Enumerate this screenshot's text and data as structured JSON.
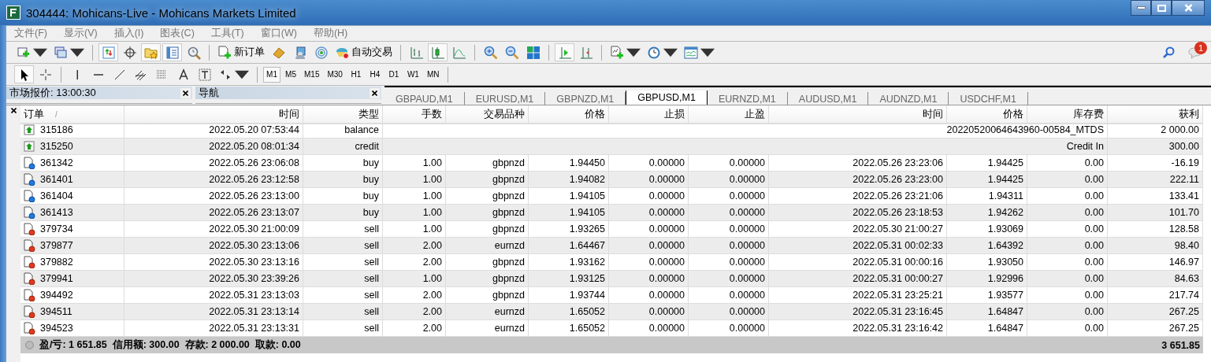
{
  "window": {
    "title": "304444: Mohicans-Live - Mohicans Markets Limited"
  },
  "menu": [
    "文件(F)",
    "显示(V)",
    "插入(I)",
    "图表(C)",
    "工具(T)",
    "窗口(W)",
    "帮助(H)"
  ],
  "toolbar": [
    {
      "kind": "icon",
      "pressed": false
    },
    {
      "kind": "icon",
      "pressed": false
    },
    {
      "kind": "separator"
    },
    {
      "kind": "icon",
      "pressed": true
    },
    {
      "kind": "icon",
      "pressed": false
    },
    {
      "kind": "icon",
      "pressed": true
    },
    {
      "kind": "icon",
      "pressed": true
    },
    {
      "kind": "icon",
      "pressed": false
    },
    {
      "kind": "separator"
    },
    {
      "kind": "labeled",
      "label": "新订单",
      "pressed": false
    },
    {
      "kind": "icon",
      "pressed": false
    },
    {
      "kind": "icon",
      "pressed": false
    },
    {
      "kind": "icon",
      "pressed": false
    },
    {
      "kind": "labeled",
      "label": "自动交易",
      "pressed": false
    },
    {
      "kind": "separator"
    },
    {
      "kind": "icon",
      "pressed": false
    },
    {
      "kind": "icon",
      "pressed": true
    },
    {
      "kind": "icon",
      "pressed": false
    },
    {
      "kind": "separator"
    },
    {
      "kind": "icon",
      "pressed": false
    },
    {
      "kind": "icon",
      "pressed": false
    },
    {
      "kind": "icon",
      "pressed": false
    },
    {
      "kind": "separator"
    },
    {
      "kind": "icon",
      "pressed": true
    },
    {
      "kind": "icon",
      "pressed": false
    },
    {
      "kind": "separator"
    },
    {
      "kind": "icon",
      "pressed": false
    },
    {
      "kind": "icon",
      "pressed": false
    },
    {
      "kind": "icon",
      "pressed": false
    }
  ],
  "notifications": {
    "badge": "1"
  },
  "drawing_tools": [
    {
      "pressed": true
    },
    {
      "pressed": false
    },
    {
      "pressed": false
    },
    {
      "pressed": false
    },
    {
      "pressed": false
    },
    {
      "pressed": false
    },
    {
      "pressed": false
    },
    {
      "pressed": false
    },
    {
      "pressed": false
    },
    {
      "pressed": false
    }
  ],
  "timeframes": [
    {
      "label": "M1",
      "selected": true
    },
    {
      "label": "M5",
      "selected": false
    },
    {
      "label": "M15",
      "selected": false
    },
    {
      "label": "M30",
      "selected": false
    },
    {
      "label": "H1",
      "selected": false
    },
    {
      "label": "H4",
      "selected": false
    },
    {
      "label": "D1",
      "selected": false
    },
    {
      "label": "W1",
      "selected": false
    },
    {
      "label": "MN",
      "selected": false
    }
  ],
  "panels": [
    {
      "title": "市场报价: 13:00:30"
    },
    {
      "title": "导航"
    }
  ],
  "chart_tabs": [
    {
      "label": "GBPAUD,M1",
      "selected": false
    },
    {
      "label": "EURUSD,M1",
      "selected": false
    },
    {
      "label": "GBPNZD,M1",
      "selected": false
    },
    {
      "label": "GBPUSD,M1",
      "selected": true
    },
    {
      "label": "EURNZD,M1",
      "selected": false
    },
    {
      "label": "AUDUSD,M1",
      "selected": false
    },
    {
      "label": "AUDNZD,M1",
      "selected": false
    },
    {
      "label": "USDCHF,M1",
      "selected": false
    }
  ],
  "table": {
    "columns": [
      "订单",
      "时间",
      "类型",
      "手数",
      "交易品种",
      "价格",
      "止损",
      "止盈",
      "时间",
      "价格",
      "库存费",
      "获利"
    ],
    "sort_mark": "/",
    "rows": [
      {
        "kind": "deposit",
        "order": "315186",
        "time": "2022.05.20 07:53:44",
        "type": "balance",
        "comment": "20220520064643960-00584_MTDS",
        "profit": "2 000.00"
      },
      {
        "kind": "deposit",
        "order": "315250",
        "time": "2022.05.20 08:01:34",
        "type": "credit",
        "comment": "Credit In",
        "profit": "300.00"
      },
      {
        "kind": "buy",
        "order": "361342",
        "time": "2022.05.26 23:06:08",
        "type": "buy",
        "lots": "1.00",
        "symbol": "gbpnzd",
        "price": "1.94450",
        "sl": "0.00000",
        "tp": "0.00000",
        "close_time": "2022.05.26 23:23:06",
        "close_price": "1.94425",
        "swap": "0.00",
        "profit": "-16.19"
      },
      {
        "kind": "buy",
        "order": "361401",
        "time": "2022.05.26 23:12:58",
        "type": "buy",
        "lots": "1.00",
        "symbol": "gbpnzd",
        "price": "1.94082",
        "sl": "0.00000",
        "tp": "0.00000",
        "close_time": "2022.05.26 23:23:00",
        "close_price": "1.94425",
        "swap": "0.00",
        "profit": "222.11"
      },
      {
        "kind": "buy",
        "order": "361404",
        "time": "2022.05.26 23:13:00",
        "type": "buy",
        "lots": "1.00",
        "symbol": "gbpnzd",
        "price": "1.94105",
        "sl": "0.00000",
        "tp": "0.00000",
        "close_time": "2022.05.26 23:21:06",
        "close_price": "1.94311",
        "swap": "0.00",
        "profit": "133.41"
      },
      {
        "kind": "buy",
        "order": "361413",
        "time": "2022.05.26 23:13:07",
        "type": "buy",
        "lots": "1.00",
        "symbol": "gbpnzd",
        "price": "1.94105",
        "sl": "0.00000",
        "tp": "0.00000",
        "close_time": "2022.05.26 23:18:53",
        "close_price": "1.94262",
        "swap": "0.00",
        "profit": "101.70"
      },
      {
        "kind": "sell",
        "order": "379734",
        "time": "2022.05.30 21:00:09",
        "type": "sell",
        "lots": "1.00",
        "symbol": "gbpnzd",
        "price": "1.93265",
        "sl": "0.00000",
        "tp": "0.00000",
        "close_time": "2022.05.30 21:00:27",
        "close_price": "1.93069",
        "swap": "0.00",
        "profit": "128.58"
      },
      {
        "kind": "sell",
        "order": "379877",
        "time": "2022.05.30 23:13:06",
        "type": "sell",
        "lots": "2.00",
        "symbol": "eurnzd",
        "price": "1.64467",
        "sl": "0.00000",
        "tp": "0.00000",
        "close_time": "2022.05.31 00:02:33",
        "close_price": "1.64392",
        "swap": "0.00",
        "profit": "98.40"
      },
      {
        "kind": "sell",
        "order": "379882",
        "time": "2022.05.30 23:13:16",
        "type": "sell",
        "lots": "2.00",
        "symbol": "gbpnzd",
        "price": "1.93162",
        "sl": "0.00000",
        "tp": "0.00000",
        "close_time": "2022.05.31 00:00:16",
        "close_price": "1.93050",
        "swap": "0.00",
        "profit": "146.97"
      },
      {
        "kind": "sell",
        "order": "379941",
        "time": "2022.05.30 23:39:26",
        "type": "sell",
        "lots": "1.00",
        "symbol": "gbpnzd",
        "price": "1.93125",
        "sl": "0.00000",
        "tp": "0.00000",
        "close_time": "2022.05.31 00:00:27",
        "close_price": "1.92996",
        "swap": "0.00",
        "profit": "84.63"
      },
      {
        "kind": "sell",
        "order": "394492",
        "time": "2022.05.31 23:13:03",
        "type": "sell",
        "lots": "2.00",
        "symbol": "gbpnzd",
        "price": "1.93744",
        "sl": "0.00000",
        "tp": "0.00000",
        "close_time": "2022.05.31 23:25:21",
        "close_price": "1.93577",
        "swap": "0.00",
        "profit": "217.74"
      },
      {
        "kind": "sell",
        "order": "394511",
        "time": "2022.05.31 23:13:14",
        "type": "sell",
        "lots": "2.00",
        "symbol": "eurnzd",
        "price": "1.65052",
        "sl": "0.00000",
        "tp": "0.00000",
        "close_time": "2022.05.31 23:16:45",
        "close_price": "1.64847",
        "swap": "0.00",
        "profit": "267.25"
      },
      {
        "kind": "sell",
        "order": "394523",
        "time": "2022.05.31 23:13:31",
        "type": "sell",
        "lots": "2.00",
        "symbol": "eurnzd",
        "price": "1.65052",
        "sl": "0.00000",
        "tp": "0.00000",
        "close_time": "2022.05.31 23:16:42",
        "close_price": "1.64847",
        "swap": "0.00",
        "profit": "267.25"
      }
    ],
    "summary": "盈/亏: 1 651.85  信用额: 300.00  存款: 2 000.00  取款: 0.00",
    "total": "3 651.85"
  }
}
